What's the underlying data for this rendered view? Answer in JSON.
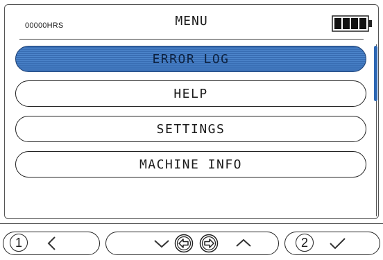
{
  "header": {
    "hours": "00000HRS",
    "title": "MENU",
    "battery_bars": 4,
    "battery_icon": "battery-full-icon"
  },
  "menu": {
    "items": [
      {
        "label": "ERROR LOG",
        "selected": true
      },
      {
        "label": "HELP",
        "selected": false
      },
      {
        "label": "SETTINGS",
        "selected": false
      },
      {
        "label": "MACHINE INFO",
        "selected": false
      }
    ]
  },
  "softkeys": {
    "key1": "1",
    "key2": "2",
    "icons": [
      "back-icon",
      "down-icon",
      "left-arrow-icon",
      "right-arrow-icon",
      "up-icon",
      "check-icon"
    ]
  },
  "colors": {
    "selected": "#3a6fb5",
    "scroll_thumb": "#2d67b3"
  }
}
